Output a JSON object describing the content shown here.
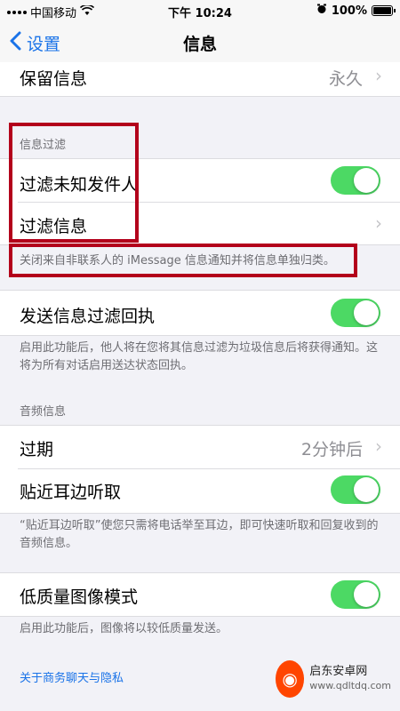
{
  "status_bar": {
    "carrier": "中国移动",
    "time": "下午 10:24",
    "battery": "100%"
  },
  "nav": {
    "back_label": "设置",
    "title": "信息"
  },
  "rows": {
    "keep_messages": {
      "label": "保留信息",
      "value": "永久"
    },
    "filter_unknown": {
      "label": "过滤未知发件人",
      "toggle": true
    },
    "filter_messages": {
      "label": "过滤信息"
    },
    "send_filter_receipt": {
      "label": "发送信息过滤回执",
      "toggle": true
    },
    "expire": {
      "label": "过期",
      "value": "2分钟后"
    },
    "raise_to_listen": {
      "label": "贴近耳边听取",
      "toggle": true
    },
    "low_quality": {
      "label": "低质量图像模式",
      "toggle": true
    }
  },
  "headers": {
    "message_filter": "信息过滤",
    "audio_messages": "音频信息"
  },
  "footers": {
    "filter_note": "关闭来自非联系人的 iMessage 信息通知并将信息单独归类。",
    "receipt_note": "启用此功能后，他人将在您将其信息过滤为垃圾信息后将获得通知。这将为所有对话启用送达状态回执。",
    "raise_note": "“贴近耳边听取”使您只需将电话举至耳边，即可快速听取和回复收到的音频信息。",
    "low_quality_note": "启用此功能后，图像将以较低质量发送。"
  },
  "link": "关于商务聊天与隐私",
  "watermark": {
    "name": "启东安卓网",
    "url": "www.qdltdq.com"
  },
  "colors": {
    "accent": "#1a73e8",
    "toggle_on": "#4cd964",
    "highlight": "#b3001b"
  }
}
